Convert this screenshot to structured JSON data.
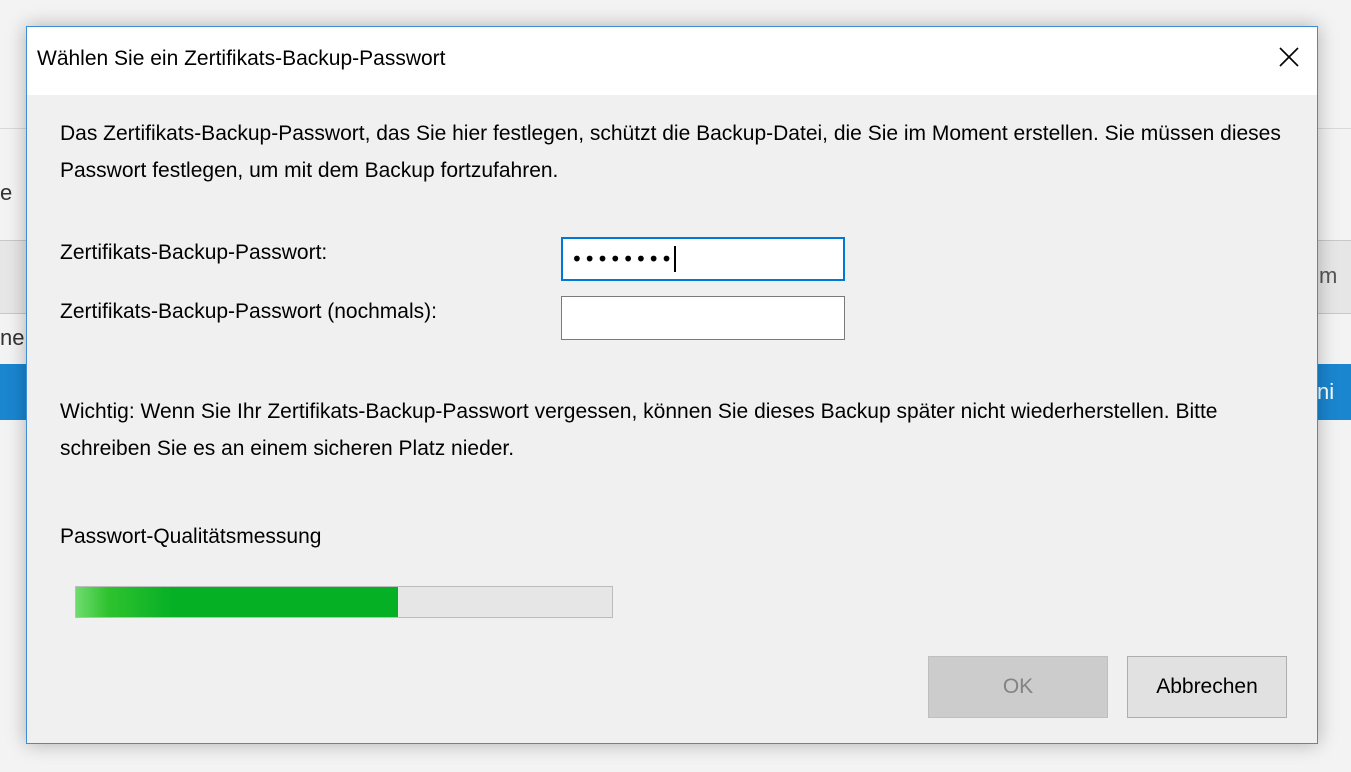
{
  "background": {
    "left_fragment_1": "e",
    "left_fragment_2": "ne",
    "right_fragment_1": "m",
    "right_fragment_2": "ni"
  },
  "dialog": {
    "title": "Wählen Sie ein Zertifikats-Backup-Passwort",
    "close_icon": "close-icon",
    "description": "Das Zertifikats-Backup-Passwort, das Sie hier festlegen, schützt die Backup-Datei, die Sie im Moment erstellen. Sie müssen dieses Passwort festlegen, um mit dem Backup fortzufahren.",
    "password_label": "Zertifikats-Backup-Passwort:",
    "password_value": "••••••••",
    "password_confirm_label": "Zertifikats-Backup-Passwort (nochmals):",
    "password_confirm_value": "",
    "warning": "Wichtig: Wenn Sie Ihr Zertifikats-Backup-Passwort vergessen, können Sie dieses Backup später nicht wiederherstellen. Bitte schreiben Sie es an einem sicheren Platz nieder.",
    "meter_label": "Passwort-Qualitätsmessung",
    "meter_fraction": 0.6,
    "ok_label": "OK",
    "ok_enabled": false,
    "cancel_label": "Abbrechen"
  },
  "colors": {
    "accent_border": "#3c8fd6",
    "meter_green": "#06b025",
    "focus_border": "#0078d7",
    "background_blue": "#1a86d0"
  }
}
